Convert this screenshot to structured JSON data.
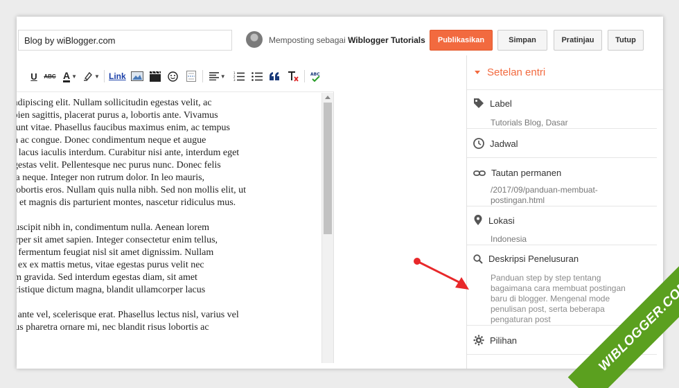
{
  "header": {
    "title_value": "Blog by wiBlogger.com",
    "posting_as_prefix": "Memposting sebagai",
    "posting_as_user": "Wiblogger Tutorials",
    "buttons": {
      "publish": "Publikasikan",
      "save": "Simpan",
      "preview": "Pratinjau",
      "close": "Tutup"
    }
  },
  "toolbar": {
    "underline": "U",
    "strikethrough": "ABC",
    "font_color": "A",
    "link": "Link",
    "icons": [
      "underline-icon",
      "strikethrough-icon",
      "font-color-icon",
      "highlight-icon",
      "link-icon",
      "image-icon",
      "video-icon",
      "emoji-icon",
      "jump-break-icon",
      "align-icon",
      "numbered-list-icon",
      "bullet-list-icon",
      "quote-icon",
      "clear-format-icon",
      "spellcheck-icon"
    ]
  },
  "editor": {
    "paragraphs": [
      [
        "ctetur adipiscing elit. Nullam sollicitudin egestas velit, ac",
        ". ac sapien sagittis, placerat purus a, lobortis ante. Vivamus",
        ". tincidunt vitae. Phasellus faucibus maximus enim, ac tempus",
        " et nibh ac congue. Donec condimentum neque et augue",
        "rat non lacus iaculis interdum. Curabitur nisi ante, interdum eget",
        "In at egestas velit. Pellentesque nec purus nunc. Donec felis",
        "entum a neque. Integer non rutrum dolor. In leo mauris,",
        "esque lobortis eros. Nullam quis nulla nibh. Sed non mollis elit, ut",
        "natibus et magnis dis parturient montes, nascetur ridiculus mus."
      ],
      [
        "dunt, suscipit nibh in, condimentum nulla. Aenean lorem",
        "llamcorper sit amet sapien. Integer consectetur enim tellus,",
        "liquam fermentum feugiat nisl sit amet dignissim. Nullam",
        "entum, ex ex mattis metus, vitae egestas purus velit nec",
        "s rutrum gravida. Sed interdum egestas diam, sit amet",
        "Proin tristique dictum magna, blandit ullamcorper lacus"
      ],
      [
        "ectetur ante vel, scelerisque erat. Phasellus lectus nisl, varius vel",
        "Vivamus pharetra ornare mi, nec blandit risus lobortis ac"
      ]
    ]
  },
  "sidebar": {
    "title": "Setelan entri",
    "items": [
      {
        "label": "Label",
        "value": "Tutorials Blog, Dasar"
      },
      {
        "label": "Jadwal",
        "value": ""
      },
      {
        "label": "Tautan permanen",
        "value": "/2017/09/panduan-membuat-\npostingan.html"
      },
      {
        "label": "Lokasi",
        "value": "Indonesia"
      },
      {
        "label": "Deskripsi Penelusuran",
        "value": "Panduan step by step tentang\nbagaimana cara membuat postingan\nbaru di blogger. Mengenal mode\npenulisan post, serta beberapa\npengaturan post"
      },
      {
        "label": "Pilihan",
        "value": ""
      }
    ]
  },
  "watermark": {
    "text": "WIBLOGGER.COM"
  },
  "colors": {
    "accent": "#f26a3f",
    "ribbon": "#5ba01f",
    "arrow": "#e8282a"
  }
}
